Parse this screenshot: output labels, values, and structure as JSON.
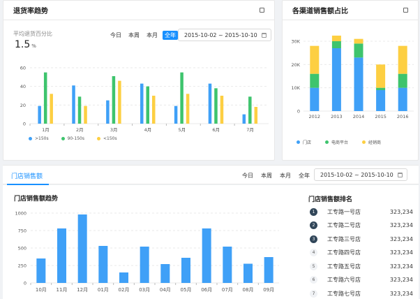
{
  "return_card": {
    "title": "退货率趋势",
    "metric_label": "平均退货百分比",
    "metric_value": "1.5",
    "metric_unit": "%",
    "periods": [
      "今日",
      "本周",
      "本月",
      "全年"
    ],
    "active_period": 3,
    "date_range": "2015-10-02 ~ 2015-10-10"
  },
  "channel_card": {
    "title": "各渠道销售额占比"
  },
  "store_tab": {
    "label": "门店销售额",
    "periods": [
      "今日",
      "本周",
      "本月",
      "全年"
    ],
    "date_range": "2015-10-02 ~ 2015-10-10"
  },
  "trend_card": {
    "title": "门店销售额趋势"
  },
  "ranking": {
    "title": "门店销售额排名",
    "items": [
      {
        "rank": "1",
        "name": "工专路一号店",
        "value": "323,234"
      },
      {
        "rank": "2",
        "name": "工专路二号店",
        "value": "323,234"
      },
      {
        "rank": "3",
        "name": "工专路三号店",
        "value": "323,234"
      },
      {
        "rank": "4",
        "name": "工专路四号店",
        "value": "323,234"
      },
      {
        "rank": "5",
        "name": "工专路五号店",
        "value": "323,234"
      },
      {
        "rank": "6",
        "name": "工专路六号店",
        "value": "323,234"
      },
      {
        "rank": "7",
        "name": "工专路七号店",
        "value": "323,234"
      }
    ]
  },
  "colors": {
    "blue": "#3fa0f7",
    "green": "#3ec46d",
    "yellow": "#fdcf42",
    "accent": "#1890ff"
  },
  "chart_data": [
    {
      "type": "bar",
      "categories": [
        "1月",
        "2月",
        "3月",
        "4月",
        "5月",
        "6月",
        "7月"
      ],
      "series": [
        {
          "name": ">150s",
          "values": [
            19,
            41,
            25,
            43,
            19,
            43,
            10
          ]
        },
        {
          "name": "90-150s",
          "values": [
            55,
            29,
            51,
            40,
            55,
            38,
            29
          ]
        },
        {
          "name": "<150s",
          "values": [
            32,
            19,
            46,
            30,
            32,
            30,
            18
          ]
        }
      ],
      "ylim": [
        0,
        60
      ],
      "yticks": [
        "0",
        "20",
        "40",
        "60"
      ],
      "legend": "bottom-left",
      "grid": true
    },
    {
      "type": "bar",
      "stacked": true,
      "categories": [
        "2012",
        "2013",
        "2014",
        "2015",
        "2016"
      ],
      "series": [
        {
          "name": "门店",
          "values": [
            10000,
            27000,
            23000,
            9000,
            10000
          ]
        },
        {
          "name": "电商平台",
          "values": [
            6000,
            3000,
            6000,
            1000,
            6000
          ]
        },
        {
          "name": "经销商",
          "values": [
            12000,
            3000,
            2000,
            10000,
            12000
          ]
        }
      ],
      "ylim": [
        0,
        30000
      ],
      "yticks": [
        "0",
        "10K",
        "20K",
        "30K"
      ],
      "legend": "bottom",
      "grid": true
    },
    {
      "type": "bar",
      "categories": [
        "10月",
        "11月",
        "12月",
        "01月",
        "02月",
        "03月",
        "04月",
        "05月",
        "06月",
        "07月",
        "08月",
        "09月"
      ],
      "values": [
        350,
        780,
        980,
        530,
        150,
        520,
        270,
        360,
        780,
        520,
        275,
        370
      ],
      "ylim": [
        0,
        1000
      ],
      "yticks": [
        "0",
        "250",
        "500",
        "750",
        "1000"
      ],
      "grid": true
    }
  ]
}
